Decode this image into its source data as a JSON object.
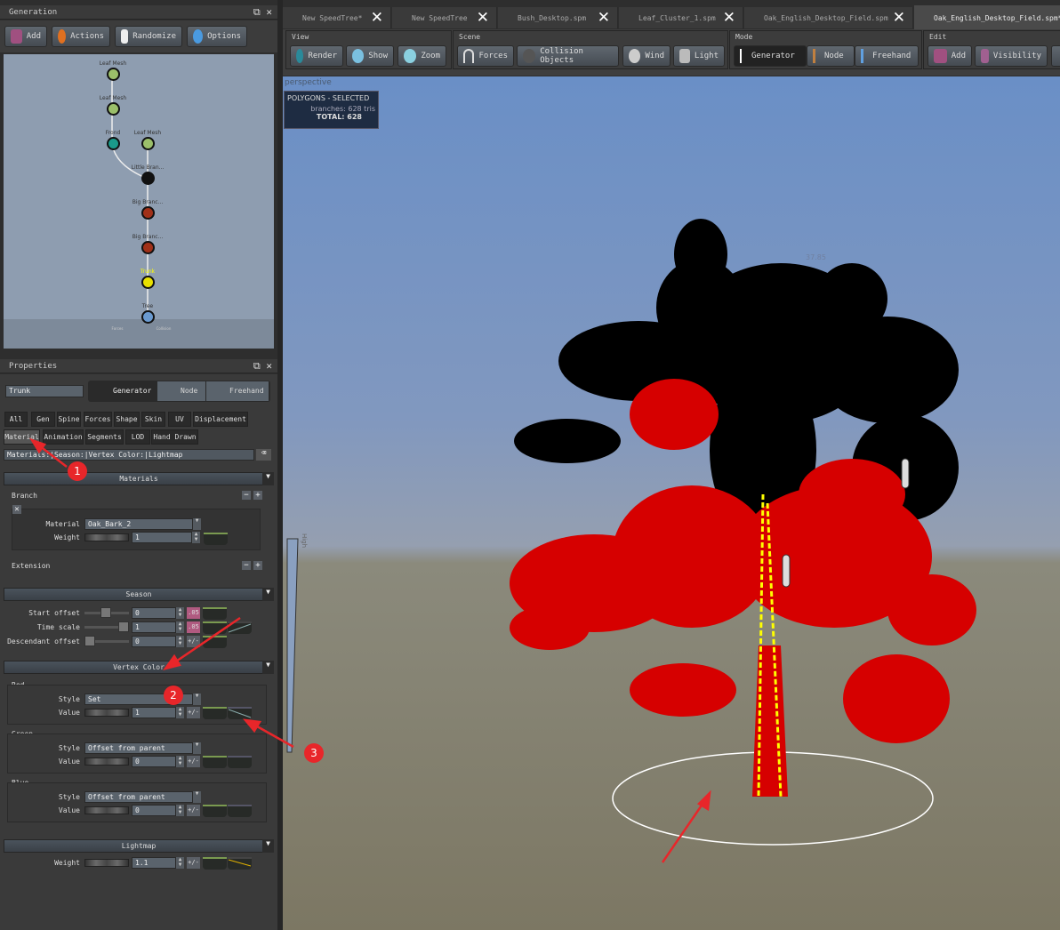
{
  "generation": {
    "title": "Generation",
    "buttons": [
      "Add",
      "Actions",
      "Randomize",
      "Options"
    ],
    "nodes": [
      {
        "label": "Leaf Mesh",
        "color": "#9bbf6a"
      },
      {
        "label": "Leaf Mesh",
        "color": "#9bbf6a"
      },
      {
        "label": "Frond",
        "color": "#1a9a8a"
      },
      {
        "label": "Leaf Mesh",
        "color": "#9bbf6a"
      },
      {
        "label": "Little Bran...",
        "color": "#111111"
      },
      {
        "label": "Big Branc...",
        "color": "#a03018"
      },
      {
        "label": "Big Branc...",
        "color": "#a03018"
      },
      {
        "label": "Trunk",
        "color": "#e8e000"
      },
      {
        "label": "Tree",
        "color": "#6a9ad0"
      }
    ],
    "bottom_labels": [
      "Forces",
      "Collision"
    ]
  },
  "tabs": [
    {
      "label": "New SpeedTree*"
    },
    {
      "label": "New SpeedTree"
    },
    {
      "label": "Bush_Desktop.spm"
    },
    {
      "label": "Leaf_Cluster_1.spm"
    },
    {
      "label": "Oak_English_Desktop_Field.spm"
    },
    {
      "label": "Oak_English_Desktop_Field.spm*"
    }
  ],
  "toolbar": {
    "view": {
      "label": "View",
      "buttons": [
        "Render",
        "Show",
        "Zoom"
      ]
    },
    "scene": {
      "label": "Scene",
      "buttons": [
        "Forces",
        "Collision Objects",
        "Wind",
        "Light"
      ]
    },
    "mode": {
      "label": "Mode",
      "buttons": [
        "Generator",
        "Node",
        "Freehand"
      ]
    },
    "edit": {
      "label": "Edit",
      "buttons": [
        "Add",
        "Visibility"
      ]
    }
  },
  "viewport": {
    "camera": "perspective",
    "stats_title": "POLYGONS - SELECTED",
    "stats_line": "branches:  628 tris",
    "stats_total": "TOTAL:  628",
    "height_label": "37.85",
    "gauge_label": "High"
  },
  "properties": {
    "title": "Properties",
    "name_value": "Trunk",
    "modes": [
      "Generator",
      "Node",
      "Freehand"
    ],
    "tabs_row1": [
      "All",
      "Gen",
      "Spine",
      "Forces",
      "Shape",
      "Skin",
      "UV",
      "Displacement"
    ],
    "tabs_row2": [
      "Material",
      "Animation",
      "Segments",
      "LOD",
      "Hand Drawn"
    ],
    "filter": "Materials:|Season:|Vertex Color:|Lightmap",
    "materials": {
      "title": "Materials",
      "branch": "Branch",
      "material_label": "Material",
      "material_value": "Oak_Bark_2",
      "weight_label": "Weight",
      "weight_value": "1",
      "extension": "Extension"
    },
    "season": {
      "title": "Season",
      "rows": [
        {
          "label": "Start offset",
          "value": "0",
          "btn": ".05"
        },
        {
          "label": "Time scale",
          "value": "1",
          "btn": ".05"
        },
        {
          "label": "Descendant offset",
          "value": "0",
          "btn": "+/-"
        }
      ]
    },
    "vertex_color": {
      "title": "Vertex Color",
      "channels": [
        {
          "name": "Red",
          "style": "Set",
          "value": "1"
        },
        {
          "name": "Green",
          "style": "Offset from parent",
          "value": "0"
        },
        {
          "name": "Blue",
          "style": "Offset from parent",
          "value": "0"
        }
      ],
      "style_label": "Style",
      "value_label": "Value",
      "pm": "+/-"
    },
    "lightmap": {
      "title": "Lightmap",
      "weight_label": "Weight",
      "weight_value": "1.1",
      "pm": "+/-"
    }
  },
  "annotations": [
    "1",
    "2",
    "3"
  ]
}
